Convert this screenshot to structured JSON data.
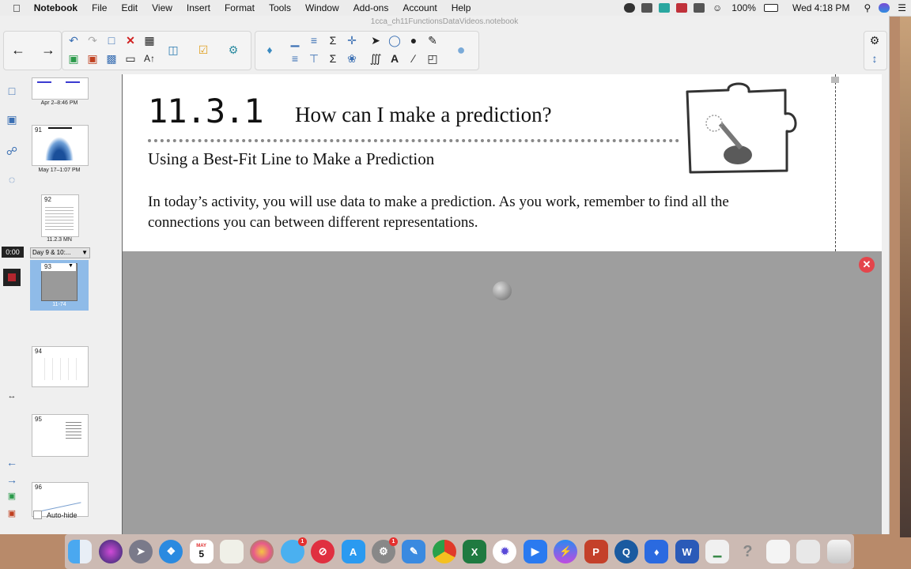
{
  "menubar": {
    "apple": "",
    "app_name": "Notebook",
    "items": [
      "File",
      "Edit",
      "View",
      "Insert",
      "Format",
      "Tools",
      "Window",
      "Add-ons",
      "Account",
      "Help"
    ],
    "battery": "100%",
    "clock": "Wed 4:18 PM"
  },
  "window": {
    "title": "1cca_ch11FunctionsDataVideos.notebook"
  },
  "sidebar": {
    "timer": "0:00",
    "auto_hide_label": "Auto-hide",
    "group_label": "Day 9 & 10:...",
    "thumbnails": [
      {
        "num": "",
        "caption": "Apr 2–8:46 PM"
      },
      {
        "num": "91",
        "caption": "May 17–1:07 PM"
      },
      {
        "num": "92",
        "caption": "11.2.3 MN"
      },
      {
        "num": "93",
        "caption": "11-74"
      },
      {
        "num": "94",
        "caption": ""
      },
      {
        "num": "95",
        "caption": ""
      },
      {
        "num": "96",
        "caption": ""
      }
    ]
  },
  "page": {
    "lesson_number": "11.3.1",
    "lesson_question": "How can I make a prediction?",
    "subtitle": "Using a Best-Fit Line to Make a Prediction",
    "intro": "In today’s activity, you will use data to make a prediction.  As you work, remember to find all the connections you can between different representations."
  },
  "dock": {
    "calendar_month": "MAY",
    "calendar_day": "5",
    "badges": {
      "messages": "1",
      "prefs": "1"
    }
  },
  "colors": {
    "accent": "#3a6fb3",
    "close_red": "#e4454b",
    "selection": "#8fbbe8",
    "canvas_gray": "#9e9e9e"
  }
}
